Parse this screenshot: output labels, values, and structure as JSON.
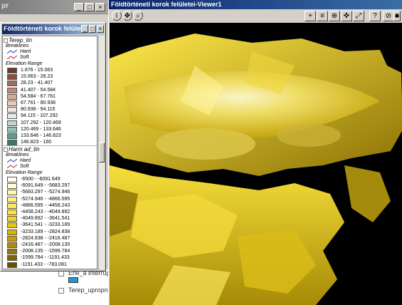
{
  "background_window": {
    "title": "pr",
    "tree_items": [
      {
        "label": "Erw_a interrupt.tin"
      },
      {
        "label": "Terep_upropnt_a"
      }
    ]
  },
  "legend_window": {
    "title": "Földtörténeti korok felületei",
    "groups": [
      {
        "name": "Terep_tin",
        "breaklines_label": "Breaklines",
        "hard_label": "Hard",
        "soft_label": "Soft",
        "range_label": "Elevation Range",
        "classes": [
          {
            "range": "1.876 - 15.063",
            "color": "#6b3a2a"
          },
          {
            "range": "15.063 - 28.23",
            "color": "#8a4e3c"
          },
          {
            "range": "28.23 - 41.407",
            "color": "#a36a56"
          },
          {
            "range": "41.407 - 54.584",
            "color": "#bd8a74"
          },
          {
            "range": "54.584 - 67.761",
            "color": "#d3ab96"
          },
          {
            "range": "67.761 - 80.938",
            "color": "#e6cbbb"
          },
          {
            "range": "80.938 - 94.115",
            "color": "#f2e4da"
          },
          {
            "range": "94.115 - 107.292",
            "color": "#e0ece8"
          },
          {
            "range": "107.292 - 120.469",
            "color": "#b8d8cf"
          },
          {
            "range": "120.469 - 133.646",
            "color": "#8fc0b3"
          },
          {
            "range": "133.646 - 146.823",
            "color": "#5f9c8c"
          },
          {
            "range": "146.823 - 160",
            "color": "#3a7a6a"
          }
        ]
      },
      {
        "name": "Harm ad_tin",
        "breaklines_label": "Breaklines",
        "hard_label": "Hard",
        "soft_label": "Soft",
        "range_label": "Elevation Range",
        "classes": [
          {
            "range": "-6500 - -6091.649",
            "color": "#fffef0"
          },
          {
            "range": "-6091.649 - -5683.297",
            "color": "#fffbd0"
          },
          {
            "range": "-5683.297 - -5274.946",
            "color": "#fff7a8"
          },
          {
            "range": "-5274.946 - -4866.595",
            "color": "#fff180"
          },
          {
            "range": "-4866.595 - -4458.243",
            "color": "#ffe95a"
          },
          {
            "range": "-4458.243 - -4049.892",
            "color": "#fde03a"
          },
          {
            "range": "-4049.892 - -3641.541",
            "color": "#f5d21e"
          },
          {
            "range": "-3641.541 - -3233.189",
            "color": "#e9c40e"
          },
          {
            "range": "-3233.189 - -2824.838",
            "color": "#d8b208"
          },
          {
            "range": "-2824.838 - -2416.487",
            "color": "#c4a006"
          },
          {
            "range": "-2416.487 - -2008.135",
            "color": "#ae8c06"
          },
          {
            "range": "-2008.135 - -1599.784",
            "color": "#967806"
          },
          {
            "range": "-1599.784 - -1191.433",
            "color": "#7e6406"
          },
          {
            "range": "-1191.433 - -783.081",
            "color": "#665006"
          }
        ]
      }
    ]
  },
  "viewer": {
    "title": "Földtörténeti korok felületei-Viewer1",
    "tools": [
      {
        "icon": "info-icon",
        "glyph": "i"
      },
      {
        "icon": "pan-icon",
        "glyph": "✥"
      },
      {
        "icon": "zoom-icon",
        "glyph": "⌕"
      },
      {
        "icon": "add-theme-icon",
        "glyph": "+"
      },
      {
        "icon": "theme-properties-icon",
        "glyph": "≡"
      },
      {
        "icon": "zoom-in-icon",
        "glyph": "⊕"
      },
      {
        "icon": "navigate-icon",
        "glyph": "✜"
      },
      {
        "icon": "full-extent-icon",
        "glyph": "⤢"
      },
      {
        "icon": "help-icon",
        "glyph": "?"
      },
      {
        "icon": "stop-icon",
        "glyph": "⊘"
      },
      {
        "icon": "close-view-icon",
        "glyph": "■"
      }
    ]
  },
  "colors": {
    "title_active": "#0a246a",
    "scene_background": "#000000",
    "surface_yellow": "#f5e14a"
  }
}
